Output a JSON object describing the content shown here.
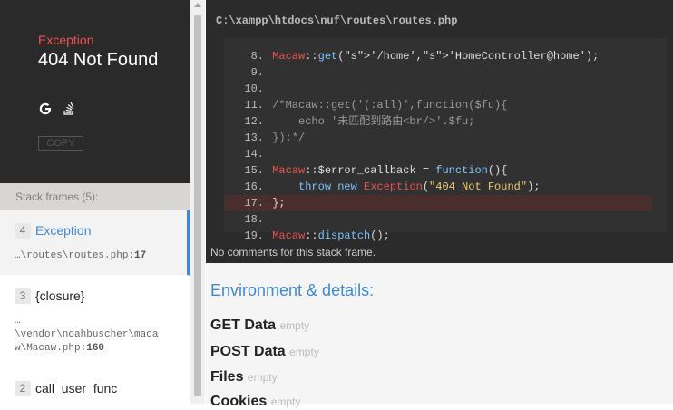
{
  "exception": {
    "type": "Exception",
    "message": "404 Not Found",
    "copy_label": "COPY"
  },
  "frames": {
    "header": "Stack frames (5):",
    "items": [
      {
        "num": "4",
        "function": "Exception",
        "file": "…\\routes\\routes.php",
        "line": "17"
      },
      {
        "num": "3",
        "function": "{closure}",
        "file_lines": [
          "…",
          "\\vendor\\noahbuscher\\maca",
          "w\\Macaw.php"
        ],
        "line": "160"
      },
      {
        "num": "2",
        "function": "call_user_func"
      }
    ]
  },
  "code": {
    "path": "C:\\xampp\\htdocs\\nuf\\routes\\routes.php",
    "lines": [
      {
        "n": "8.",
        "text": "Macaw::get('/home','HomeController@home');"
      },
      {
        "n": "9.",
        "text": ""
      },
      {
        "n": "10.",
        "text": ""
      },
      {
        "n": "11.",
        "text": "/*Macaw::get('(:all)',function($fu){"
      },
      {
        "n": "12.",
        "text": "    echo '未匹配到路由<br/>'.$fu;"
      },
      {
        "n": "13.",
        "text": "});*/"
      },
      {
        "n": "14.",
        "text": ""
      },
      {
        "n": "15.",
        "text": "Macaw::$error_callback = function(){"
      },
      {
        "n": "16.",
        "text": "    throw new Exception(\"404 Not Found\");"
      },
      {
        "n": "17.",
        "text": "};"
      },
      {
        "n": "18.",
        "text": ""
      },
      {
        "n": "19.",
        "text": "Macaw::dispatch();"
      }
    ],
    "no_comments": "No comments for this stack frame."
  },
  "details": {
    "title": "Environment & details:",
    "rows": [
      {
        "label": "GET Data",
        "value": "empty"
      },
      {
        "label": "POST Data",
        "value": "empty"
      },
      {
        "label": "Files",
        "value": "empty"
      },
      {
        "label": "Cookies",
        "value": "empty"
      }
    ]
  },
  "colors": {
    "accent": "#4288ce",
    "error": "#e95353",
    "panel_dark": "#2a2a2a"
  }
}
